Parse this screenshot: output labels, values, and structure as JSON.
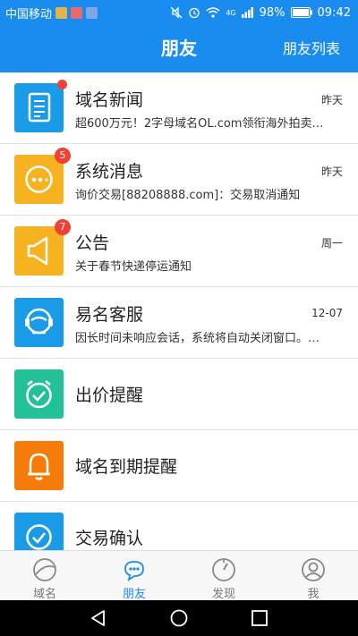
{
  "status_bar": {
    "carrier": "中国移动",
    "battery": "98%",
    "time": "09:42",
    "network": "4G"
  },
  "header": {
    "title": "朋友",
    "action": "朋友列表"
  },
  "conversations": [
    {
      "title": "域名新闻",
      "time": "昨天",
      "preview": "超600万元！2字母域名OL.com领衔海外拍卖…",
      "badge": "",
      "icon": "news-icon",
      "color": "#1a9be8"
    },
    {
      "title": "系统消息",
      "time": "昨天",
      "preview": "询价交易[88208888.com]：交易取消通知",
      "badge": "5",
      "icon": "chat-bubble-icon",
      "color": "#f7b21f"
    },
    {
      "title": "公告",
      "time": "周一",
      "preview": "关于春节快递停运通知",
      "badge": "7",
      "icon": "megaphone-icon",
      "color": "#f7b21f"
    },
    {
      "title": "易名客服",
      "time": "12-07",
      "preview": "因长时间未响应会话，系统将自动关闭窗口。…",
      "badge": "",
      "icon": "headset-icon",
      "color": "#1a9be8"
    },
    {
      "title": "出价提醒",
      "time": "",
      "preview": "",
      "badge": "",
      "icon": "alarm-clock-icon",
      "color": "#22c197"
    },
    {
      "title": "域名到期提醒",
      "time": "",
      "preview": "",
      "badge": "",
      "icon": "bell-icon",
      "color": "#f57c0a"
    },
    {
      "title": "交易确认",
      "time": "",
      "preview": "",
      "badge": "",
      "icon": "check-circle-icon",
      "color": "#1a9be8"
    }
  ],
  "tabs": [
    {
      "label": "域名",
      "icon": "globe-icon",
      "active": false
    },
    {
      "label": "朋友",
      "icon": "chat-icon",
      "active": true
    },
    {
      "label": "发现",
      "icon": "compass-icon",
      "active": false
    },
    {
      "label": "我",
      "icon": "person-icon",
      "active": false
    }
  ],
  "colors": {
    "primary": "#1a8cf0",
    "badge": "#f04134"
  }
}
